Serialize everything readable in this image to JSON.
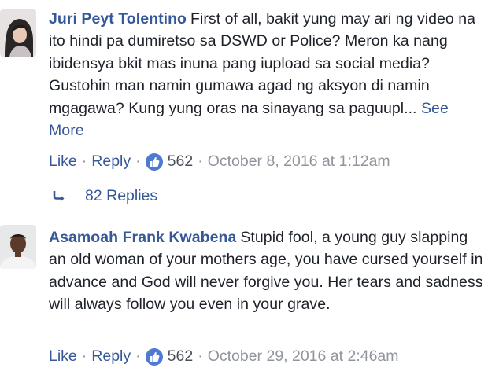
{
  "comments": [
    {
      "author": "Juri Peyt Tolentino",
      "text": "First of all, bakit yung may ari ng video na ito hindi pa dumiretso sa DSWD or Police? Meron ka nang ibidensya bkit mas inuna pang iupload sa social media? Gustohin man namin gumawa agad ng aksyon di namin mgagawa? Kung yung oras na sinayang sa paguupl...",
      "see_more": "See More",
      "like_label": "Like",
      "reply_label": "Reply",
      "reaction_count": "562",
      "timestamp": "October 8, 2016 at 1:12am",
      "replies_label": "82 Replies"
    },
    {
      "author": "Asamoah Frank Kwabena",
      "text": "Stupid fool, a young guy slapping an old woman of your mothers age, you have cursed yourself in advance and God will never forgive you. Her tears and sadness will always follow you even in your grave.",
      "like_label": "Like",
      "reply_label": "Reply",
      "reaction_count": "562",
      "timestamp": "October 29, 2016 at 2:46am"
    }
  ],
  "separator": "·",
  "colors": {
    "link": "#365899",
    "meta": "#90949c",
    "like_badge": "#4f7ad2"
  }
}
